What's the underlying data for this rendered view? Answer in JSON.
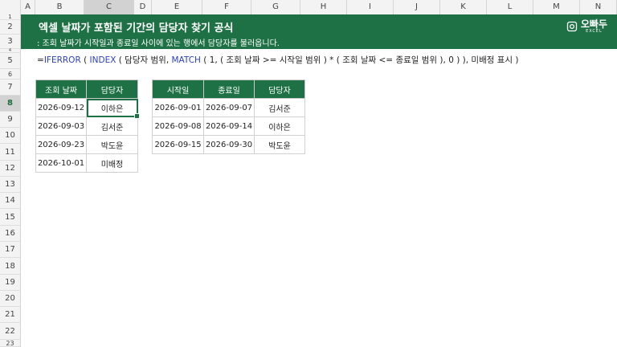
{
  "columns": [
    "A",
    "B",
    "C",
    "D",
    "E",
    "F",
    "G",
    "H",
    "I",
    "J",
    "K",
    "L",
    "M",
    "N"
  ],
  "rows": [
    "1",
    "2",
    "3",
    "4",
    "5",
    "6",
    "7",
    "8",
    "9",
    "10",
    "11",
    "12",
    "13",
    "14",
    "15",
    "16",
    "17",
    "18",
    "19",
    "20",
    "21",
    "22",
    "23"
  ],
  "banner": {
    "title": "엑셀 날짜가 포함된 기간의 담당자 찾기 공식",
    "subtitle": ": 조회 날짜가 시작일과 종료일 사이에 있는 행에서 담당자를 불러옵니다."
  },
  "logo": {
    "name": "오빠두",
    "tag": "EXCEL"
  },
  "formula": {
    "eq": "=",
    "fn1": "IFERROR",
    "p1": " ( ",
    "fn2": "INDEX",
    "p2": " ( 담당자 범위, ",
    "fn3": "MATCH",
    "p3": " ( 1, ( 조회 날짜 >= 시작일 범위 ) * ( 조회 날짜 <= 종료일 범위 ), 0 ) ), 미배정 표시 )"
  },
  "lookup_table": {
    "headers": [
      "조회 날짜",
      "담당자"
    ],
    "rows": [
      [
        "2026-09-12",
        "이하은"
      ],
      [
        "2026-09-03",
        "김서준"
      ],
      [
        "2026-09-23",
        "박도윤"
      ],
      [
        "2026-10-01",
        "미배정"
      ]
    ]
  },
  "period_table": {
    "headers": [
      "시작일",
      "종료일",
      "담당자"
    ],
    "rows": [
      [
        "2026-09-01",
        "2026-09-07",
        "김서준"
      ],
      [
        "2026-09-08",
        "2026-09-14",
        "이하은"
      ],
      [
        "2026-09-15",
        "2026-09-30",
        "박도윤"
      ]
    ]
  },
  "colors": {
    "header_green": "#1e7145",
    "formula_fn_blue": "#2c3ec4"
  }
}
